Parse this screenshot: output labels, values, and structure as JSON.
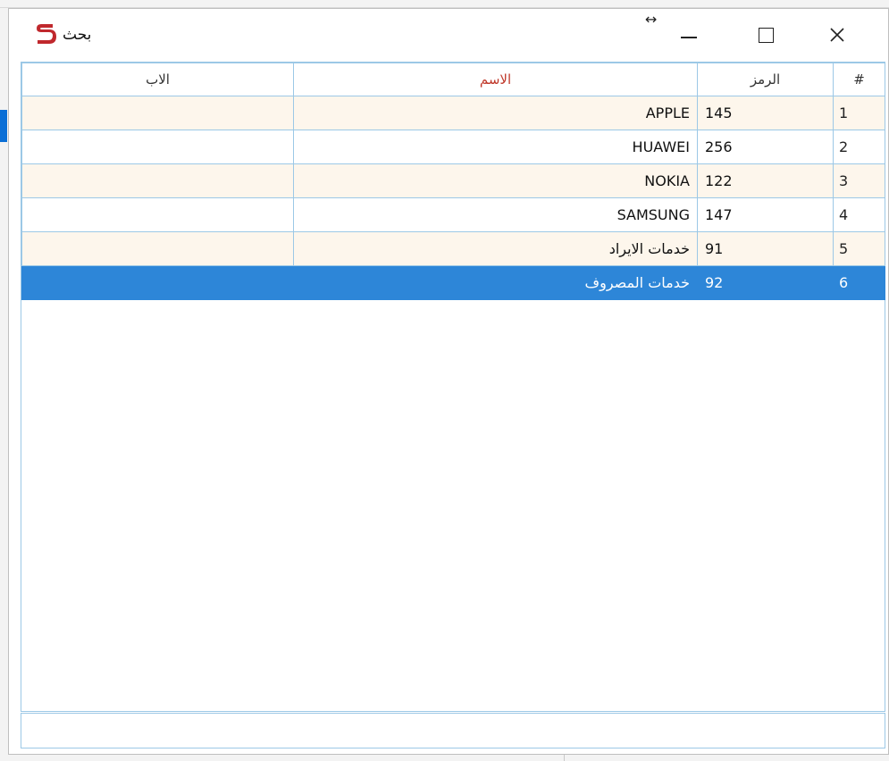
{
  "window": {
    "title": "بحث",
    "icons": [
      "app-logo-icon",
      "resize-horizontal-icon",
      "minimize-icon",
      "maximize-icon",
      "close-icon"
    ]
  },
  "table": {
    "headers": {
      "index": "#",
      "code": "الرمز",
      "name": "الاسم",
      "parent": "الاب"
    },
    "header_name_color": "#c0392b",
    "selected_row_color": "#2d86d8",
    "alternate_row_color": "#fdf6ec",
    "rows": [
      {
        "index": "1",
        "code": "145",
        "name": "APPLE",
        "parent": ""
      },
      {
        "index": "2",
        "code": "256",
        "name": "HUAWEI",
        "parent": ""
      },
      {
        "index": "3",
        "code": "122",
        "name": "NOKIA",
        "parent": ""
      },
      {
        "index": "4",
        "code": "147",
        "name": "SAMSUNG",
        "parent": ""
      },
      {
        "index": "5",
        "code": "91",
        "name": "خدمات الايراد",
        "parent": ""
      },
      {
        "index": "6",
        "code": "92",
        "name": "خدمات المصروف",
        "parent": ""
      }
    ],
    "selected_index": "6"
  },
  "footer": {
    "value": ""
  }
}
